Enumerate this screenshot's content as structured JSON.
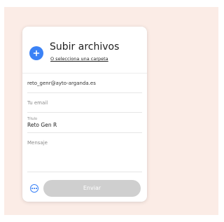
{
  "upload": {
    "title": "Subir archivos",
    "folder_link": "O selecciona una carpeta"
  },
  "form": {
    "to_value": "reto_genr@ayto-arganda.es",
    "email_placeholder": "Tu email",
    "title_label": "Título",
    "title_value": "Reto Gen R",
    "message_placeholder": "Mensaje"
  },
  "footer": {
    "send_label": "Enviar"
  },
  "colors": {
    "accent": "#3b82f6",
    "backdrop": "#fbece6",
    "send_disabled": "#cfcfcf"
  },
  "icons": {
    "add": "plus-icon",
    "options": "more-options-icon"
  }
}
